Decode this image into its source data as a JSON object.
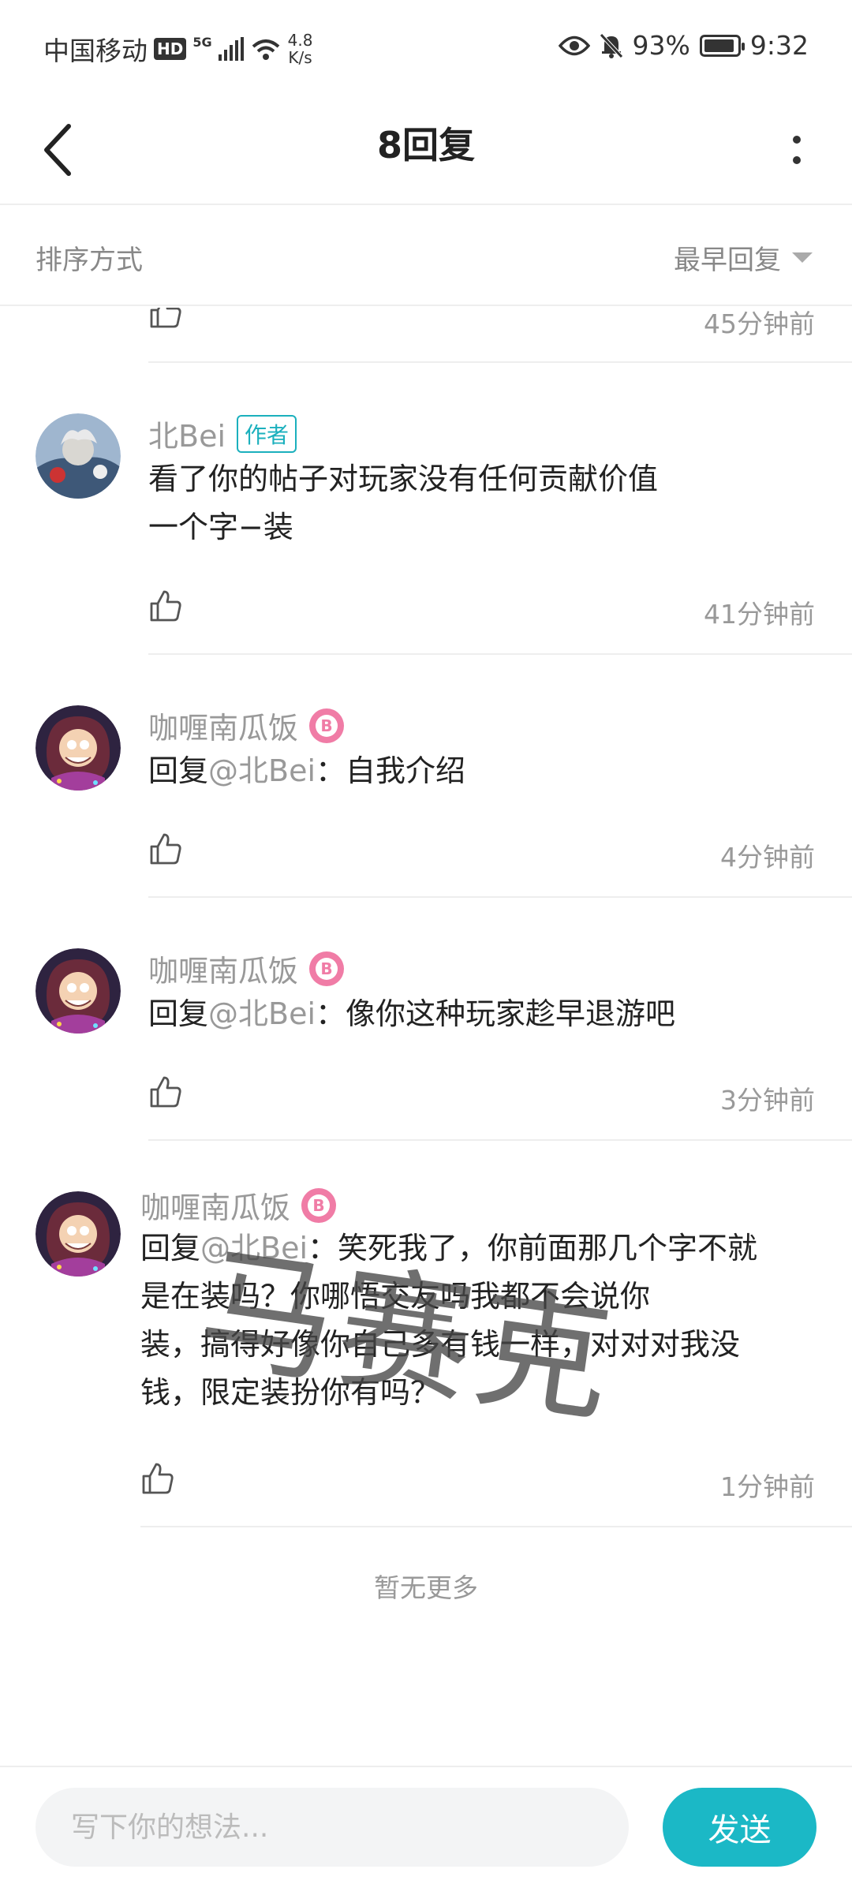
{
  "status_bar": {
    "carrier": "中国移动",
    "hd": "HD",
    "network": "5G",
    "speed_value": "4.8",
    "speed_unit": "K/s",
    "battery": "93%",
    "battery_level": 0.93,
    "time": "9:32"
  },
  "header": {
    "title": "8回复",
    "back_icon": "chevron-left-icon",
    "more_icon": "more-vertical-icon"
  },
  "sort": {
    "label": "排序方式",
    "selected": "最早回复"
  },
  "replies": [
    {
      "time": "45分钟前"
    },
    {
      "name": "北Bei",
      "tag": "作者",
      "lines": [
        "看了你的帖子对玩家没有任何贡献价值",
        "一个字−装"
      ],
      "time": "41分钟前"
    },
    {
      "name": "咖喱南瓜饭",
      "reply_prefix": "回复",
      "mention": "@北Bei",
      "text": "：自我介绍",
      "time": "4分钟前"
    },
    {
      "name": "咖喱南瓜饭",
      "reply_prefix": "回复",
      "mention": "@北Bei",
      "text": "：像你这种玩家趁早退游吧",
      "time": "3分钟前"
    },
    {
      "name": "咖喱南瓜饭",
      "line1_prefix": "回复",
      "line1_mention": "@北Bei",
      "line1_text": "：笑死我了，你前面那几个字不就",
      "lines": [
        "是在装吗？你哪悟交友吗我都不会说你",
        "装，搞得好像你自己多有钱一样，对对对我没",
        "钱，限定装扮你有吗？"
      ],
      "time": "1分钟前"
    }
  ],
  "no_more": "暂无更多",
  "watermark": "马赛克",
  "composer": {
    "placeholder": "写下你的想法...",
    "send_label": "发送"
  },
  "colors": {
    "accent": "#1bb8c6",
    "level_badge": "#f07ca6"
  }
}
